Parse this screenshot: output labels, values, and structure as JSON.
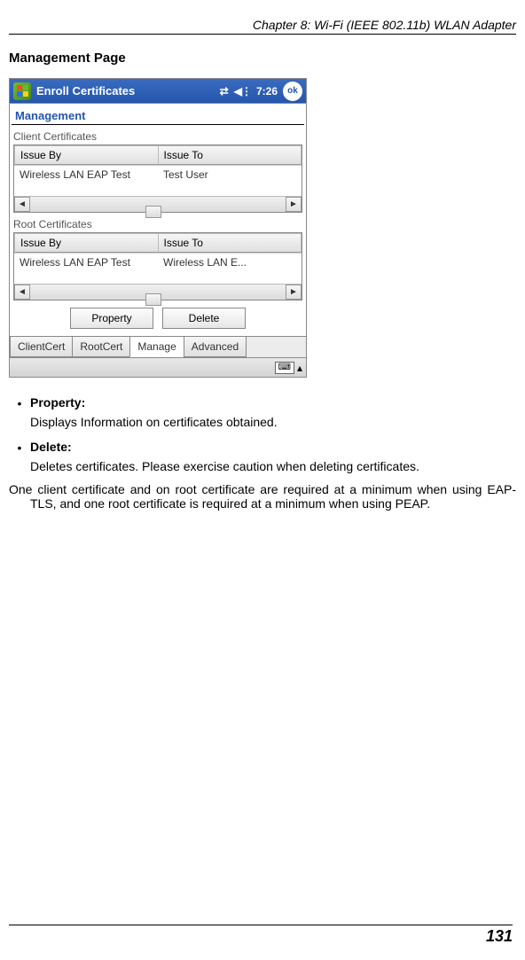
{
  "chapter_header": "Chapter 8: Wi-Fi (IEEE 802.11b) WLAN Adapter",
  "section_title": "Management Page",
  "screenshot": {
    "titlebar": {
      "title": "Enroll Certificates",
      "time": "7:26",
      "ok_label": "ok"
    },
    "management_label": "Management",
    "client_certs": {
      "label": "Client Certificates",
      "col1": "Issue By",
      "col2": "Issue To",
      "row1_col1": "Wireless LAN EAP Test",
      "row1_col2": "Test User"
    },
    "root_certs": {
      "label": "Root Certificates",
      "col1": "Issue By",
      "col2": "Issue To",
      "row1_col1": "Wireless LAN EAP Test",
      "row1_col2": "Wireless LAN E..."
    },
    "buttons": {
      "property": "Property",
      "delete": "Delete"
    },
    "tabs": {
      "t1": "ClientCert",
      "t2": "RootCert",
      "t3": "Manage",
      "t4": "Advanced"
    }
  },
  "bullets": {
    "property": {
      "title": "Property:",
      "desc": "Displays Information on certificates obtained."
    },
    "delete": {
      "title": "Delete:",
      "desc": "Deletes certificates. Please exercise caution when deleting certificates."
    }
  },
  "final_paragraph": "One client certificate and on root certificate are required at a minimum when using EAP-TLS, and one root certificate is required at a minimum when using PEAP.",
  "page_number": "131"
}
